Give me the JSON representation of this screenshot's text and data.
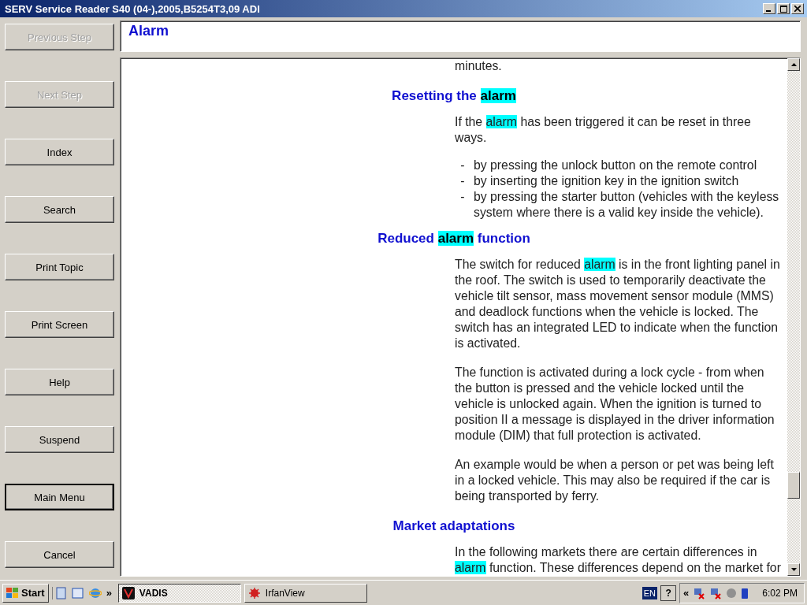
{
  "window": {
    "title": "SERV Service Reader S40 (04-),2005,B5254T3,09 ADI"
  },
  "nav_buttons": [
    {
      "label": "Previous Step",
      "disabled": true,
      "default": false
    },
    {
      "label": "Next Step",
      "disabled": true,
      "default": false
    },
    {
      "label": "Index",
      "disabled": false,
      "default": false
    },
    {
      "label": "Search",
      "disabled": false,
      "default": false
    },
    {
      "label": "Print Topic",
      "disabled": false,
      "default": false
    },
    {
      "label": "Print Screen",
      "disabled": false,
      "default": false
    },
    {
      "label": "Help",
      "disabled": false,
      "default": false
    },
    {
      "label": "Suspend",
      "disabled": false,
      "default": false
    },
    {
      "label": "Main Menu",
      "disabled": false,
      "default": true
    },
    {
      "label": "Cancel",
      "disabled": false,
      "default": false
    }
  ],
  "topic_title": "Alarm",
  "content": [
    {
      "kind": "paragraph",
      "segments": [
        {
          "text": "minutes.",
          "highlighted": false
        }
      ]
    },
    {
      "kind": "heading",
      "segments": [
        {
          "text": "Resetting the ",
          "highlighted": false
        },
        {
          "text": "alarm",
          "highlighted": true
        }
      ]
    },
    {
      "kind": "paragraph",
      "segments": [
        {
          "text": "If the ",
          "highlighted": false
        },
        {
          "text": "alarm",
          "highlighted": true
        },
        {
          "text": " has been triggered it can be reset in three ways.",
          "highlighted": false
        }
      ]
    },
    {
      "kind": "list",
      "items": [
        {
          "bullet": "-",
          "text": "by pressing the unlock button on the remote control"
        },
        {
          "bullet": "-",
          "text": "by inserting the ignition key in the ignition switch"
        },
        {
          "bullet": "-",
          "text": "by pressing the starter button (vehicles with the keyless system where there is a valid key inside the vehicle)."
        }
      ]
    },
    {
      "kind": "heading",
      "segments": [
        {
          "text": "Reduced ",
          "highlighted": false
        },
        {
          "text": "alarm",
          "highlighted": true
        },
        {
          "text": " function",
          "highlighted": false
        }
      ]
    },
    {
      "kind": "paragraph",
      "segments": [
        {
          "text": "The switch for reduced ",
          "highlighted": false
        },
        {
          "text": "alarm",
          "highlighted": true
        },
        {
          "text": " is in the front lighting panel in the roof. The switch is used to temporarily deactivate the vehicle tilt sensor, mass movement sensor module (MMS) and deadlock functions when the vehicle is locked. The switch has an integrated LED to indicate when the function is activated.",
          "highlighted": false
        }
      ]
    },
    {
      "kind": "paragraph",
      "segments": [
        {
          "text": "The function is activated during a lock cycle - from when the button is pressed and the vehicle locked until the vehicle is unlocked again. When the ignition is turned to position II a message is displayed in the driver information module (DIM) that full protection is activated.",
          "highlighted": false
        }
      ]
    },
    {
      "kind": "paragraph",
      "segments": [
        {
          "text": "An example would be when a person or pet was being left in a locked vehicle. This may also be required if the car is being transported by ferry.",
          "highlighted": false
        }
      ]
    },
    {
      "kind": "heading",
      "segments": [
        {
          "text": "Market adaptations",
          "highlighted": false
        }
      ]
    },
    {
      "kind": "paragraph",
      "segments": [
        {
          "text": "In the following markets there are certain differences in ",
          "highlighted": false
        },
        {
          "text": "alarm",
          "highlighted": true
        },
        {
          "text": " function. These differences depend on the market for",
          "highlighted": false
        }
      ]
    }
  ],
  "taskbar": {
    "start": "Start",
    "chevron": "»",
    "tasks": [
      {
        "label": "VADIS",
        "selected": true
      },
      {
        "label": "IrfanView",
        "selected": false
      }
    ],
    "language": "EN",
    "help": "?",
    "tray_chevron": "«",
    "clock": "6:02 PM"
  }
}
